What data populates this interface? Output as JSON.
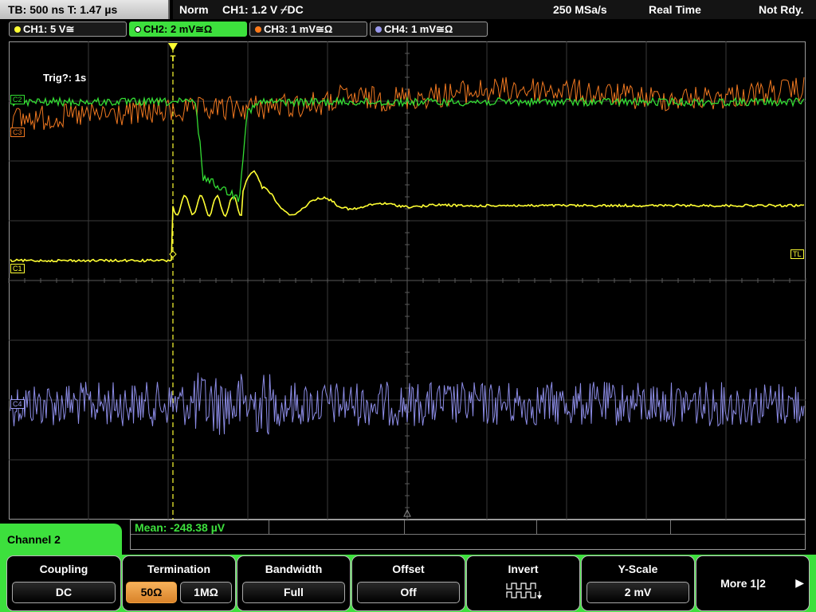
{
  "status": {
    "timebase": "TB: 500 ns   T: 1.47 µs",
    "mode": "Norm",
    "trigger_info": "CH1: 1.2 V ⌿DC",
    "sample_rate": "250 MSa/s",
    "acq_mode": "Real Time",
    "ready": "Not Rdy."
  },
  "channels": [
    {
      "label": "CH1: 5 V≅",
      "color": "#ffff33"
    },
    {
      "label": "CH2: 2 mV≅Ω",
      "color": "#33dd33"
    },
    {
      "label": "CH3: 1 mV≅Ω",
      "color": "#ff7a1a"
    },
    {
      "label": "CH4: 1 mV≅Ω",
      "color": "#9999ee"
    }
  ],
  "waveform": {
    "trig_text": "Trig?: 1s",
    "labels": {
      "c1": "C1",
      "c2": "C2",
      "c3": "C3",
      "c4": "C4",
      "tl": "TL"
    },
    "trigger_marker": "T"
  },
  "measurement": {
    "mean": "Mean: -248.38 µV"
  },
  "menu": {
    "title": "Channel 2",
    "coupling_title": "Coupling",
    "coupling_value": "DC",
    "termination_title": "Termination",
    "term_50": "50Ω",
    "term_1m": "1MΩ",
    "bandwidth_title": "Bandwidth",
    "bandwidth_value": "Full",
    "offset_title": "Offset",
    "offset_value": "Off",
    "invert_title": "Invert",
    "yscale_title": "Y-Scale",
    "yscale_value": "2 mV",
    "more": "More 1|2",
    "more_arrow": "▶"
  },
  "colors": {
    "accent": "#3de03d",
    "selected": "#e8952f"
  }
}
